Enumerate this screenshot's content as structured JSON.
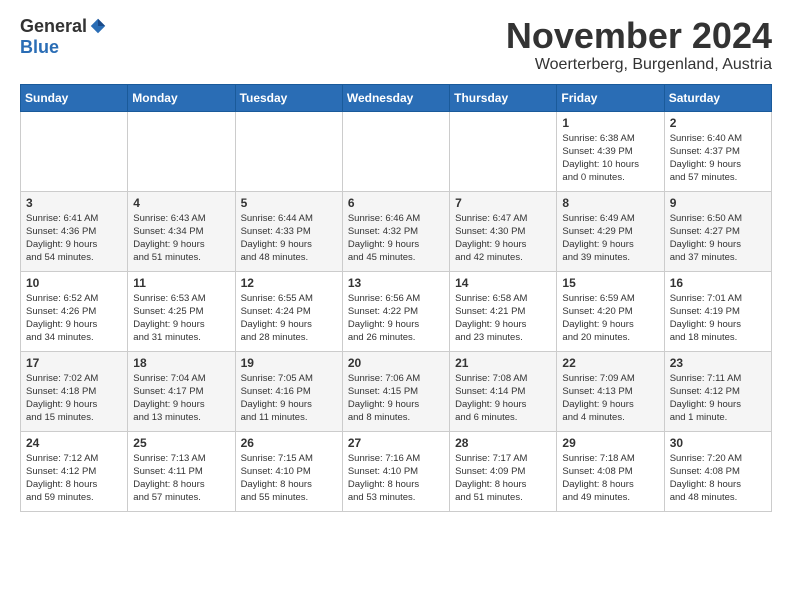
{
  "header": {
    "logo_general": "General",
    "logo_blue": "Blue",
    "month_title": "November 2024",
    "location": "Woerterberg, Burgenland, Austria"
  },
  "days_of_week": [
    "Sunday",
    "Monday",
    "Tuesday",
    "Wednesday",
    "Thursday",
    "Friday",
    "Saturday"
  ],
  "weeks": [
    {
      "row": 1,
      "days": [
        {
          "num": "",
          "info": ""
        },
        {
          "num": "",
          "info": ""
        },
        {
          "num": "",
          "info": ""
        },
        {
          "num": "",
          "info": ""
        },
        {
          "num": "",
          "info": ""
        },
        {
          "num": "1",
          "info": "Sunrise: 6:38 AM\nSunset: 4:39 PM\nDaylight: 10 hours\nand 0 minutes."
        },
        {
          "num": "2",
          "info": "Sunrise: 6:40 AM\nSunset: 4:37 PM\nDaylight: 9 hours\nand 57 minutes."
        }
      ]
    },
    {
      "row": 2,
      "days": [
        {
          "num": "3",
          "info": "Sunrise: 6:41 AM\nSunset: 4:36 PM\nDaylight: 9 hours\nand 54 minutes."
        },
        {
          "num": "4",
          "info": "Sunrise: 6:43 AM\nSunset: 4:34 PM\nDaylight: 9 hours\nand 51 minutes."
        },
        {
          "num": "5",
          "info": "Sunrise: 6:44 AM\nSunset: 4:33 PM\nDaylight: 9 hours\nand 48 minutes."
        },
        {
          "num": "6",
          "info": "Sunrise: 6:46 AM\nSunset: 4:32 PM\nDaylight: 9 hours\nand 45 minutes."
        },
        {
          "num": "7",
          "info": "Sunrise: 6:47 AM\nSunset: 4:30 PM\nDaylight: 9 hours\nand 42 minutes."
        },
        {
          "num": "8",
          "info": "Sunrise: 6:49 AM\nSunset: 4:29 PM\nDaylight: 9 hours\nand 39 minutes."
        },
        {
          "num": "9",
          "info": "Sunrise: 6:50 AM\nSunset: 4:27 PM\nDaylight: 9 hours\nand 37 minutes."
        }
      ]
    },
    {
      "row": 3,
      "days": [
        {
          "num": "10",
          "info": "Sunrise: 6:52 AM\nSunset: 4:26 PM\nDaylight: 9 hours\nand 34 minutes."
        },
        {
          "num": "11",
          "info": "Sunrise: 6:53 AM\nSunset: 4:25 PM\nDaylight: 9 hours\nand 31 minutes."
        },
        {
          "num": "12",
          "info": "Sunrise: 6:55 AM\nSunset: 4:24 PM\nDaylight: 9 hours\nand 28 minutes."
        },
        {
          "num": "13",
          "info": "Sunrise: 6:56 AM\nSunset: 4:22 PM\nDaylight: 9 hours\nand 26 minutes."
        },
        {
          "num": "14",
          "info": "Sunrise: 6:58 AM\nSunset: 4:21 PM\nDaylight: 9 hours\nand 23 minutes."
        },
        {
          "num": "15",
          "info": "Sunrise: 6:59 AM\nSunset: 4:20 PM\nDaylight: 9 hours\nand 20 minutes."
        },
        {
          "num": "16",
          "info": "Sunrise: 7:01 AM\nSunset: 4:19 PM\nDaylight: 9 hours\nand 18 minutes."
        }
      ]
    },
    {
      "row": 4,
      "days": [
        {
          "num": "17",
          "info": "Sunrise: 7:02 AM\nSunset: 4:18 PM\nDaylight: 9 hours\nand 15 minutes."
        },
        {
          "num": "18",
          "info": "Sunrise: 7:04 AM\nSunset: 4:17 PM\nDaylight: 9 hours\nand 13 minutes."
        },
        {
          "num": "19",
          "info": "Sunrise: 7:05 AM\nSunset: 4:16 PM\nDaylight: 9 hours\nand 11 minutes."
        },
        {
          "num": "20",
          "info": "Sunrise: 7:06 AM\nSunset: 4:15 PM\nDaylight: 9 hours\nand 8 minutes."
        },
        {
          "num": "21",
          "info": "Sunrise: 7:08 AM\nSunset: 4:14 PM\nDaylight: 9 hours\nand 6 minutes."
        },
        {
          "num": "22",
          "info": "Sunrise: 7:09 AM\nSunset: 4:13 PM\nDaylight: 9 hours\nand 4 minutes."
        },
        {
          "num": "23",
          "info": "Sunrise: 7:11 AM\nSunset: 4:12 PM\nDaylight: 9 hours\nand 1 minute."
        }
      ]
    },
    {
      "row": 5,
      "days": [
        {
          "num": "24",
          "info": "Sunrise: 7:12 AM\nSunset: 4:12 PM\nDaylight: 8 hours\nand 59 minutes."
        },
        {
          "num": "25",
          "info": "Sunrise: 7:13 AM\nSunset: 4:11 PM\nDaylight: 8 hours\nand 57 minutes."
        },
        {
          "num": "26",
          "info": "Sunrise: 7:15 AM\nSunset: 4:10 PM\nDaylight: 8 hours\nand 55 minutes."
        },
        {
          "num": "27",
          "info": "Sunrise: 7:16 AM\nSunset: 4:10 PM\nDaylight: 8 hours\nand 53 minutes."
        },
        {
          "num": "28",
          "info": "Sunrise: 7:17 AM\nSunset: 4:09 PM\nDaylight: 8 hours\nand 51 minutes."
        },
        {
          "num": "29",
          "info": "Sunrise: 7:18 AM\nSunset: 4:08 PM\nDaylight: 8 hours\nand 49 minutes."
        },
        {
          "num": "30",
          "info": "Sunrise: 7:20 AM\nSunset: 4:08 PM\nDaylight: 8 hours\nand 48 minutes."
        }
      ]
    }
  ]
}
